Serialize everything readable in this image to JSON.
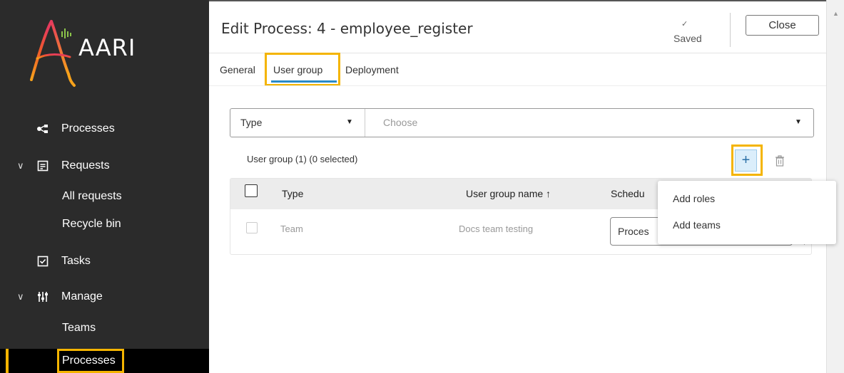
{
  "app": {
    "name": "AARI"
  },
  "sidebar": {
    "items": [
      {
        "label": "Processes",
        "icon": "processes-icon"
      },
      {
        "label": "Requests",
        "icon": "requests-icon",
        "expanded": true
      },
      {
        "label": "All requests"
      },
      {
        "label": "Recycle bin"
      },
      {
        "label": "Tasks",
        "icon": "tasks-icon"
      },
      {
        "label": "Manage",
        "icon": "manage-icon",
        "expanded": true
      },
      {
        "label": "Teams"
      },
      {
        "label": "Processes",
        "active": true
      }
    ]
  },
  "header": {
    "title": "Edit Process: 4 - employee_register",
    "saved_icon": "✓",
    "saved_label": "Saved",
    "close_label": "Close"
  },
  "tabs": [
    {
      "label": "General"
    },
    {
      "label": "User group",
      "active": true
    },
    {
      "label": "Deployment"
    }
  ],
  "filter": {
    "type_label": "Type",
    "choose_placeholder": "Choose"
  },
  "user_group": {
    "summary": "User group (1) (0 selected)",
    "add_label": "+",
    "columns": [
      "Type",
      "User group name ↑",
      "Schedu"
    ],
    "rows": [
      {
        "type": "Team",
        "name": "Docs team testing",
        "selection": "Proces"
      }
    ]
  },
  "menu": {
    "items": [
      {
        "label": "Add roles"
      },
      {
        "label": "Add teams"
      }
    ]
  },
  "colors": {
    "sidebar_bg": "#2b2b2b",
    "highlight": "#f4b400",
    "accent": "#2a8bc7"
  }
}
